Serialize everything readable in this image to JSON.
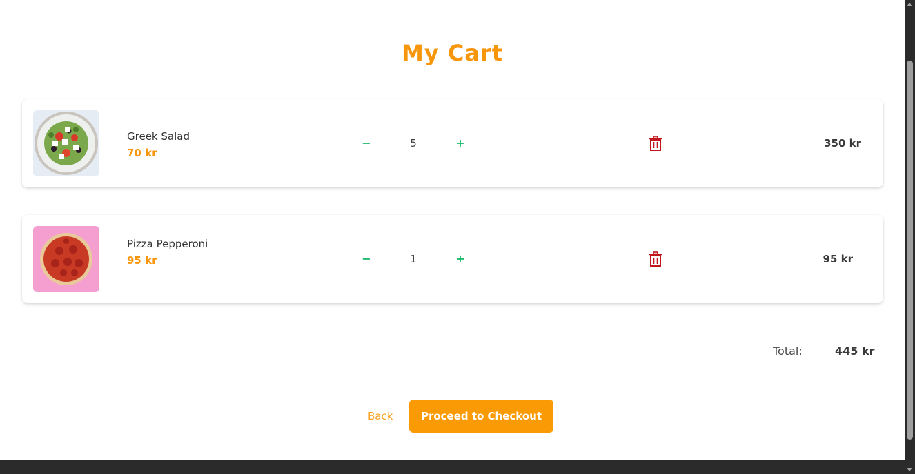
{
  "page": {
    "title": "My Cart"
  },
  "colors": {
    "accent": "#f7960a",
    "button": "#fa9a05",
    "qty_controls": "#1dba6c",
    "delete": "#c0161c"
  },
  "cart": {
    "items": [
      {
        "name": "Greek Salad",
        "unit_price": "70 kr",
        "quantity": "5",
        "line_total": "350 kr",
        "minus_label": "−",
        "plus_label": "+",
        "delete_icon": "trash-icon"
      },
      {
        "name": "Pizza Pepperoni",
        "unit_price": "95 kr",
        "quantity": "1",
        "line_total": "95 kr",
        "minus_label": "−",
        "plus_label": "+",
        "delete_icon": "trash-icon"
      }
    ],
    "total_label": "Total:",
    "total_value": "445 kr"
  },
  "actions": {
    "back_label": "Back",
    "checkout_label": "Proceed to Checkout"
  }
}
